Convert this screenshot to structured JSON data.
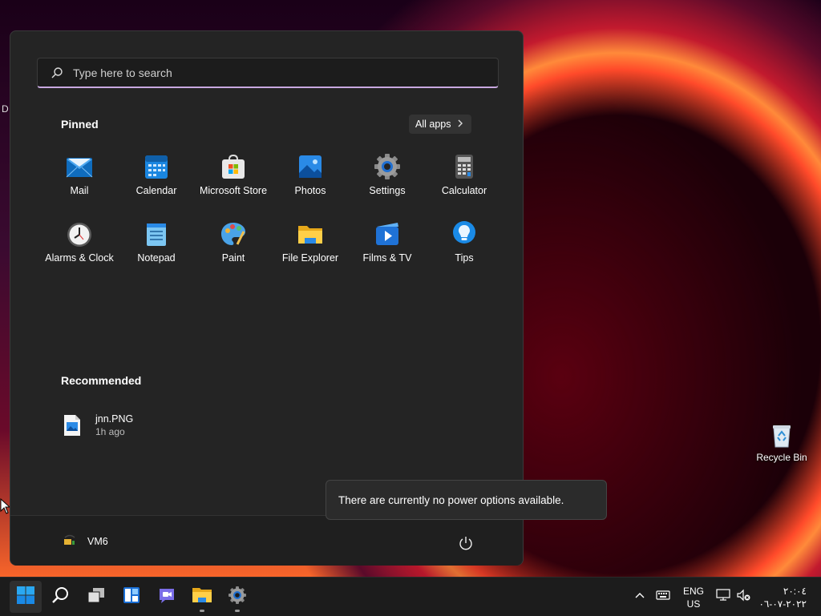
{
  "desktop": {
    "partial_text": "D",
    "recycle_bin_label": "Recycle Bin"
  },
  "start_menu": {
    "search_placeholder": "Type here to search",
    "pinned_title": "Pinned",
    "all_apps_label": "All apps",
    "pinned_apps": [
      {
        "label": "Mail",
        "icon": "mail-icon"
      },
      {
        "label": "Calendar",
        "icon": "calendar-icon"
      },
      {
        "label": "Microsoft Store",
        "icon": "store-icon"
      },
      {
        "label": "Photos",
        "icon": "photos-icon"
      },
      {
        "label": "Settings",
        "icon": "gear-icon"
      },
      {
        "label": "Calculator",
        "icon": "calculator-icon"
      },
      {
        "label": "Alarms & Clock",
        "icon": "clock-icon"
      },
      {
        "label": "Notepad",
        "icon": "notepad-icon"
      },
      {
        "label": "Paint",
        "icon": "palette-icon"
      },
      {
        "label": "File Explorer",
        "icon": "folder-icon"
      },
      {
        "label": "Films & TV",
        "icon": "play-icon"
      },
      {
        "label": "Tips",
        "icon": "lightbulb-icon"
      }
    ],
    "recommended_title": "Recommended",
    "recommended": [
      {
        "name": "jnn.PNG",
        "time": "1h ago"
      }
    ],
    "user_name": "VM6"
  },
  "tooltip": {
    "text": "There are currently no power options available."
  },
  "taskbar": {
    "apps": [
      "start-icon",
      "search-icon",
      "task-view-icon",
      "widgets-icon",
      "chat-icon",
      "file-explorer-icon",
      "settings-icon"
    ],
    "lang_line1": "ENG",
    "lang_line2": "US",
    "time": "٢٠:٠٤",
    "date": "٢٠٢٢-٠٧-٠٦"
  },
  "colors": {
    "accent": "#c8a8e0",
    "menu_bg": "#242424",
    "taskbar_bg": "#1c1c1c"
  }
}
